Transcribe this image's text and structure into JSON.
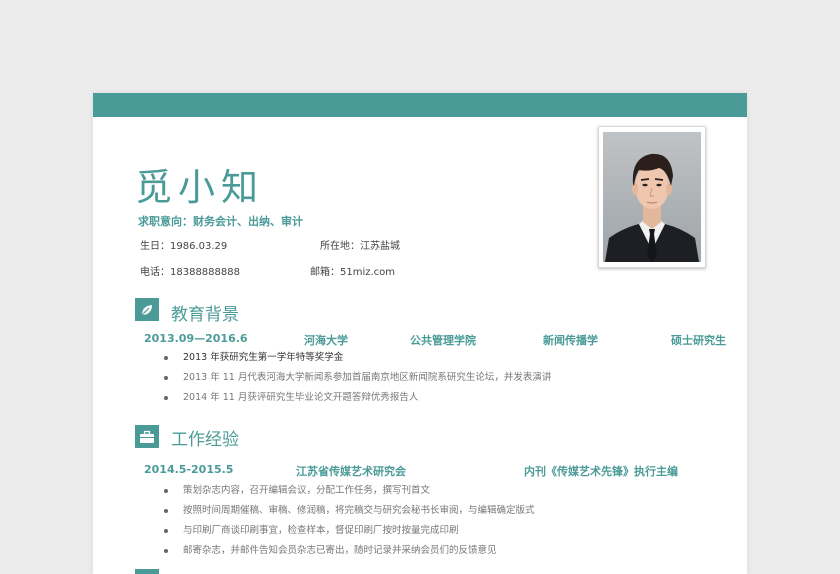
{
  "name": "觅小知",
  "objective": "求职意向：财务会计、出纳、审计",
  "info": {
    "birthday": "生日：1986.03.29",
    "location": "所在地：江苏盐城",
    "phone": "电话：18388888888",
    "email": "邮箱：51miz.com"
  },
  "education": {
    "title": "教育背景",
    "period": "2013.09—2016.6",
    "school": "河海大学",
    "college": "公共管理学院",
    "major": "新闻传播学",
    "degree": "硕士研究生",
    "items": [
      "2013 年获研究生第一学年特等奖学金",
      "2013 年 11 月代表河海大学新闻系参加首届南京地区新闻院系研究生论坛，并发表演讲",
      "2014 年 11 月获评研究生毕业论文开题答辩优秀报告人"
    ]
  },
  "work": {
    "title": "工作经验",
    "period": "2014.5-2015.5",
    "org": "江苏省传媒艺术研究会",
    "role": "内刊《传媒艺术先锋》执行主编",
    "items": [
      "策划杂志内容，召开编辑会议，分配工作任务，撰写刊首文",
      "按照时间周期催稿、审稿、修润稿，将完稿交与研究会秘书长审阅，与编辑确定版式",
      "与印刷厂商谈印刷事宜，检查样本，督促印刷厂按时按量完成印刷",
      "邮寄杂志，并邮件告知会员杂志已寄出，随时记录并采纳会员们的反馈意见"
    ]
  },
  "colors": {
    "accent": "#4a9b98",
    "page_bg": "#ececec"
  },
  "icons": {
    "education": "leaf-icon",
    "work": "briefcase-icon"
  }
}
